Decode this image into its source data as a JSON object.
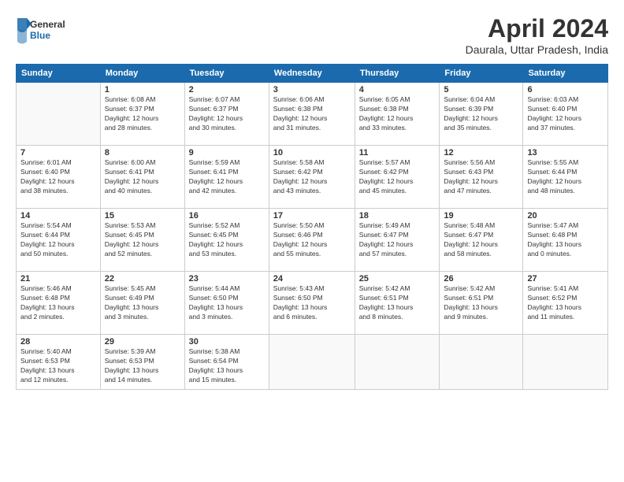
{
  "header": {
    "logo": {
      "general": "General",
      "blue": "Blue"
    },
    "title": "April 2024",
    "location": "Daurala, Uttar Pradesh, India"
  },
  "calendar": {
    "days_of_week": [
      "Sunday",
      "Monday",
      "Tuesday",
      "Wednesday",
      "Thursday",
      "Friday",
      "Saturday"
    ],
    "weeks": [
      [
        {
          "day": "",
          "info": ""
        },
        {
          "day": "1",
          "info": "Sunrise: 6:08 AM\nSunset: 6:37 PM\nDaylight: 12 hours\nand 28 minutes."
        },
        {
          "day": "2",
          "info": "Sunrise: 6:07 AM\nSunset: 6:37 PM\nDaylight: 12 hours\nand 30 minutes."
        },
        {
          "day": "3",
          "info": "Sunrise: 6:06 AM\nSunset: 6:38 PM\nDaylight: 12 hours\nand 31 minutes."
        },
        {
          "day": "4",
          "info": "Sunrise: 6:05 AM\nSunset: 6:38 PM\nDaylight: 12 hours\nand 33 minutes."
        },
        {
          "day": "5",
          "info": "Sunrise: 6:04 AM\nSunset: 6:39 PM\nDaylight: 12 hours\nand 35 minutes."
        },
        {
          "day": "6",
          "info": "Sunrise: 6:03 AM\nSunset: 6:40 PM\nDaylight: 12 hours\nand 37 minutes."
        }
      ],
      [
        {
          "day": "7",
          "info": "Sunrise: 6:01 AM\nSunset: 6:40 PM\nDaylight: 12 hours\nand 38 minutes."
        },
        {
          "day": "8",
          "info": "Sunrise: 6:00 AM\nSunset: 6:41 PM\nDaylight: 12 hours\nand 40 minutes."
        },
        {
          "day": "9",
          "info": "Sunrise: 5:59 AM\nSunset: 6:41 PM\nDaylight: 12 hours\nand 42 minutes."
        },
        {
          "day": "10",
          "info": "Sunrise: 5:58 AM\nSunset: 6:42 PM\nDaylight: 12 hours\nand 43 minutes."
        },
        {
          "day": "11",
          "info": "Sunrise: 5:57 AM\nSunset: 6:42 PM\nDaylight: 12 hours\nand 45 minutes."
        },
        {
          "day": "12",
          "info": "Sunrise: 5:56 AM\nSunset: 6:43 PM\nDaylight: 12 hours\nand 47 minutes."
        },
        {
          "day": "13",
          "info": "Sunrise: 5:55 AM\nSunset: 6:44 PM\nDaylight: 12 hours\nand 48 minutes."
        }
      ],
      [
        {
          "day": "14",
          "info": "Sunrise: 5:54 AM\nSunset: 6:44 PM\nDaylight: 12 hours\nand 50 minutes."
        },
        {
          "day": "15",
          "info": "Sunrise: 5:53 AM\nSunset: 6:45 PM\nDaylight: 12 hours\nand 52 minutes."
        },
        {
          "day": "16",
          "info": "Sunrise: 5:52 AM\nSunset: 6:45 PM\nDaylight: 12 hours\nand 53 minutes."
        },
        {
          "day": "17",
          "info": "Sunrise: 5:50 AM\nSunset: 6:46 PM\nDaylight: 12 hours\nand 55 minutes."
        },
        {
          "day": "18",
          "info": "Sunrise: 5:49 AM\nSunset: 6:47 PM\nDaylight: 12 hours\nand 57 minutes."
        },
        {
          "day": "19",
          "info": "Sunrise: 5:48 AM\nSunset: 6:47 PM\nDaylight: 12 hours\nand 58 minutes."
        },
        {
          "day": "20",
          "info": "Sunrise: 5:47 AM\nSunset: 6:48 PM\nDaylight: 13 hours\nand 0 minutes."
        }
      ],
      [
        {
          "day": "21",
          "info": "Sunrise: 5:46 AM\nSunset: 6:48 PM\nDaylight: 13 hours\nand 2 minutes."
        },
        {
          "day": "22",
          "info": "Sunrise: 5:45 AM\nSunset: 6:49 PM\nDaylight: 13 hours\nand 3 minutes."
        },
        {
          "day": "23",
          "info": "Sunrise: 5:44 AM\nSunset: 6:50 PM\nDaylight: 13 hours\nand 3 minutes."
        },
        {
          "day": "24",
          "info": "Sunrise: 5:43 AM\nSunset: 6:50 PM\nDaylight: 13 hours\nand 6 minutes."
        },
        {
          "day": "25",
          "info": "Sunrise: 5:42 AM\nSunset: 6:51 PM\nDaylight: 13 hours\nand 8 minutes."
        },
        {
          "day": "26",
          "info": "Sunrise: 5:42 AM\nSunset: 6:51 PM\nDaylight: 13 hours\nand 9 minutes."
        },
        {
          "day": "27",
          "info": "Sunrise: 5:41 AM\nSunset: 6:52 PM\nDaylight: 13 hours\nand 11 minutes."
        }
      ],
      [
        {
          "day": "28",
          "info": "Sunrise: 5:40 AM\nSunset: 6:53 PM\nDaylight: 13 hours\nand 12 minutes."
        },
        {
          "day": "29",
          "info": "Sunrise: 5:39 AM\nSunset: 6:53 PM\nDaylight: 13 hours\nand 14 minutes."
        },
        {
          "day": "30",
          "info": "Sunrise: 5:38 AM\nSunset: 6:54 PM\nDaylight: 13 hours\nand 15 minutes."
        },
        {
          "day": "",
          "info": ""
        },
        {
          "day": "",
          "info": ""
        },
        {
          "day": "",
          "info": ""
        },
        {
          "day": "",
          "info": ""
        }
      ]
    ]
  }
}
